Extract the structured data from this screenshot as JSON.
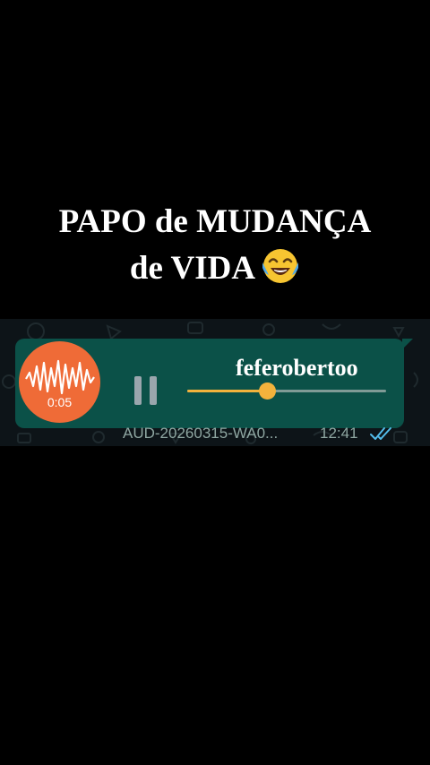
{
  "caption": {
    "line1": "PAPO de MUDANÇA",
    "line2": "de VIDA",
    "emoji": "face-with-tears-of-joy"
  },
  "watermark": "feferobertoo",
  "voice_message": {
    "duration": "0:05",
    "filename": "AUD-20260315-WA0...",
    "time": "12:41",
    "status_icon": "double-check-read-icon",
    "play_state": "pause-icon",
    "progress_fraction": 0.4,
    "colors": {
      "bubble": "#0b5148",
      "avatar": "#ef6b37",
      "progress": "#f3b23c",
      "ticks": "#53bdeb",
      "background": "#000000"
    }
  }
}
